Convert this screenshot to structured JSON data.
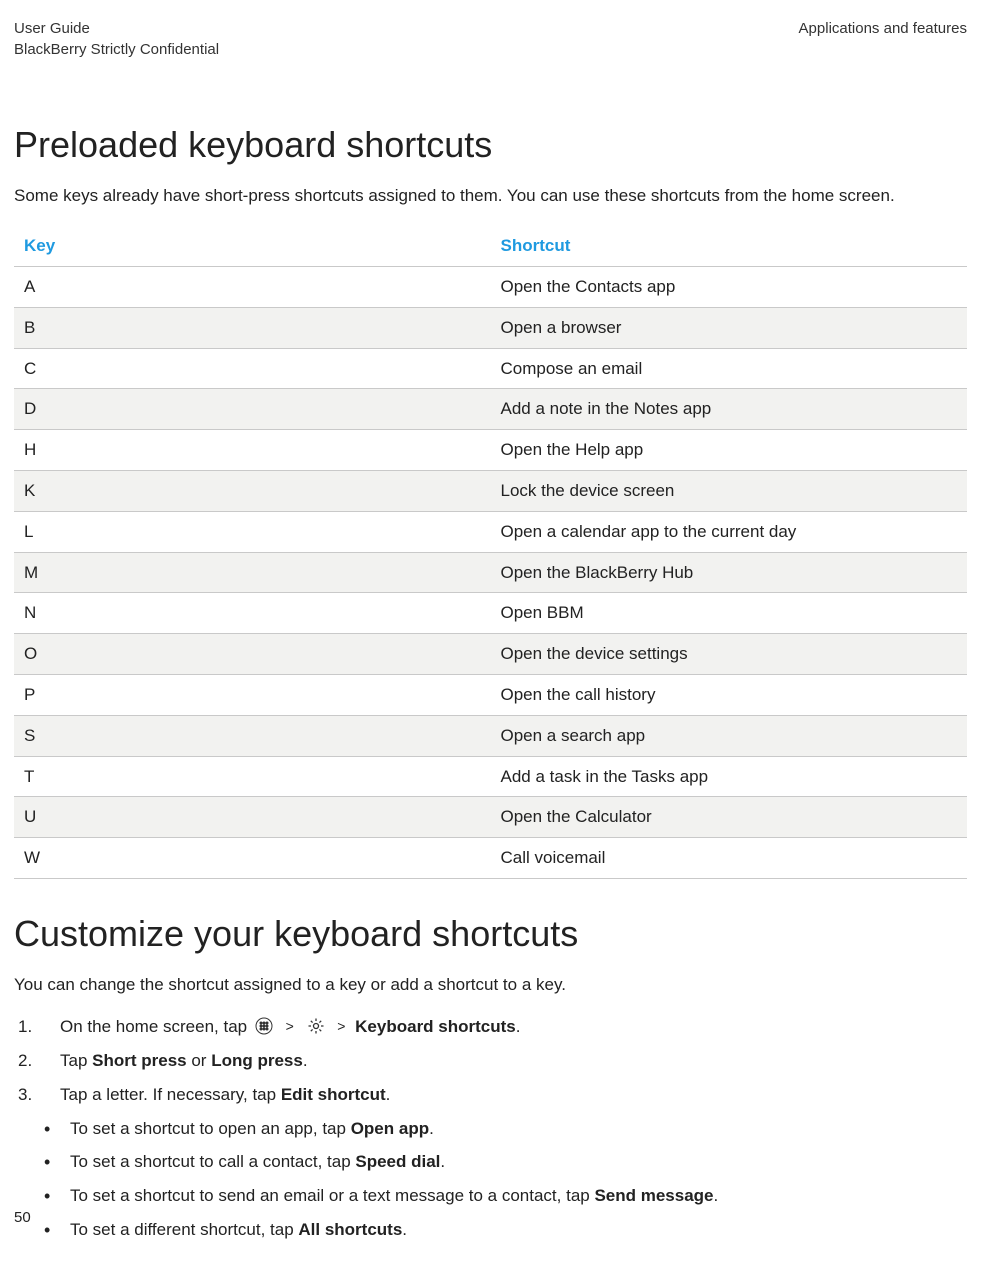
{
  "header": {
    "left_line1": "User Guide",
    "left_line2": "BlackBerry Strictly Confidential",
    "right_line1": "Applications and features"
  },
  "section1": {
    "title": "Preloaded keyboard shortcuts",
    "intro": "Some keys already have short-press shortcuts assigned to them. You can use these shortcuts from the home screen.",
    "col_key": "Key",
    "col_shortcut": "Shortcut",
    "rows": [
      {
        "key": "A",
        "shortcut": "Open the Contacts app"
      },
      {
        "key": "B",
        "shortcut": "Open a browser"
      },
      {
        "key": "C",
        "shortcut": "Compose an email"
      },
      {
        "key": "D",
        "shortcut": "Add a note in the Notes app"
      },
      {
        "key": "H",
        "shortcut": "Open the Help app"
      },
      {
        "key": "K",
        "shortcut": "Lock the device screen"
      },
      {
        "key": "L",
        "shortcut": "Open a calendar app to the current day"
      },
      {
        "key": "M",
        "shortcut": "Open the BlackBerry Hub"
      },
      {
        "key": "N",
        "shortcut": "Open BBM"
      },
      {
        "key": "O",
        "shortcut": "Open the device settings"
      },
      {
        "key": "P",
        "shortcut": "Open the call history"
      },
      {
        "key": "S",
        "shortcut": "Open a search app"
      },
      {
        "key": "T",
        "shortcut": "Add a task in the Tasks app"
      },
      {
        "key": "U",
        "shortcut": "Open the Calculator"
      },
      {
        "key": "W",
        "shortcut": "Call voicemail"
      }
    ]
  },
  "section2": {
    "title": "Customize your keyboard shortcuts",
    "intro": "You can change the shortcut assigned to a key or add a shortcut to a key.",
    "step1_prefix": "On the home screen, tap ",
    "step1_kb": "Keyboard shortcuts",
    "step1_chevron": ">",
    "step1_suffix": ".",
    "step2_prefix": "Tap ",
    "step2_short": "Short press",
    "step2_or": " or ",
    "step2_long": "Long press",
    "step2_suffix": ".",
    "step3_prefix": "Tap a letter. If necessary, tap ",
    "step3_edit": "Edit shortcut",
    "step3_suffix": ".",
    "bullets": [
      {
        "prefix": "To set a shortcut to open an app, tap ",
        "bold": "Open app",
        "suffix": "."
      },
      {
        "prefix": "To set a shortcut to call a contact, tap ",
        "bold": "Speed dial",
        "suffix": "."
      },
      {
        "prefix": "To set a shortcut to send an email or a text message to a contact, tap ",
        "bold": "Send message",
        "suffix": "."
      },
      {
        "prefix": "To set a different shortcut, tap ",
        "bold": "All shortcuts",
        "suffix": "."
      }
    ]
  },
  "page_number": "50"
}
